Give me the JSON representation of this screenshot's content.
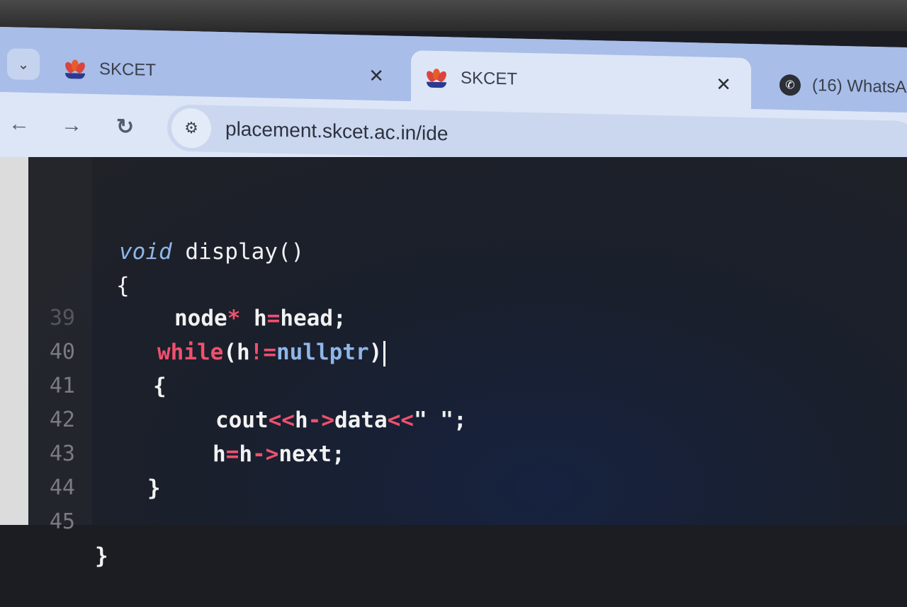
{
  "browser": {
    "tab_menu_icon": "chevron-down-icon",
    "tabs": [
      {
        "title": "SKCET",
        "icon": "skcet-logo-icon",
        "active": false,
        "close": "✕"
      },
      {
        "title": "SKCET",
        "icon": "skcet-logo-icon",
        "active": true,
        "close": "✕"
      },
      {
        "title": "(16) WhatsAp",
        "icon": "whatsapp-icon",
        "active": false
      }
    ],
    "nav": {
      "back": "←",
      "forward": "→",
      "reload": "↻"
    },
    "site_info_icon": "tune-icon",
    "url": "placement.skcet.ac.in/ide"
  },
  "editor": {
    "lines": [
      {
        "num": "",
        "code": "void display()"
      },
      {
        "num": "",
        "code": "{"
      },
      {
        "num": "",
        "code": "node* h=head;"
      },
      {
        "num": "39",
        "code": "while(h!=nullptr)"
      },
      {
        "num": "40",
        "code": "{"
      },
      {
        "num": "41",
        "code": "cout<<h->data<<\" \";"
      },
      {
        "num": "42",
        "code": "h=h->next;"
      },
      {
        "num": "43",
        "code": "}"
      },
      {
        "num": "44",
        "code": ""
      },
      {
        "num": "45",
        "code": "}"
      }
    ],
    "colors": {
      "keyword": "#f0506e",
      "type": "#8fb6e8",
      "text": "#f2f2f2",
      "line_number": "#7a7c80"
    }
  }
}
